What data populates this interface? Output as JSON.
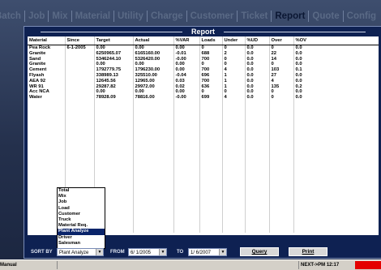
{
  "tabs": [
    "Batch",
    "Job",
    "Mix",
    "Material",
    "Utility",
    "Charge",
    "Customer",
    "Ticket",
    "Report",
    "Quote",
    "Config"
  ],
  "active_tab": "Report",
  "panel_title": "Report",
  "table": {
    "headers": [
      "Material",
      "Since",
      "Target",
      "Actual",
      "%VAR",
      "Loads",
      "Under",
      "%UD",
      "Over",
      "%OV"
    ],
    "rows": [
      [
        "Pea Rock",
        "6-1-2005",
        "0.00",
        "0.00",
        "0.00",
        "0",
        "0",
        "0.0",
        "0",
        "0.0"
      ],
      [
        "Granite",
        "",
        "6250965.07",
        "6165160.00",
        "-0.01",
        "688",
        "2",
        "0.0",
        "22",
        "0.0"
      ],
      [
        "Sand",
        "",
        "5346244.10",
        "5326420.00",
        "-0.00",
        "700",
        "0",
        "0.0",
        "14",
        "0.0"
      ],
      [
        "Granite",
        "",
        "0.00",
        "0.00",
        "0.00",
        "0",
        "0",
        "0.0",
        "0",
        "0.0"
      ],
      [
        "Cement",
        "",
        "1792779.75",
        "1796230.00",
        "0.00",
        "700",
        "4",
        "0.0",
        "103",
        "0.1"
      ],
      [
        "Flyash",
        "",
        "338989.13",
        "325510.00",
        "-0.04",
        "696",
        "1",
        "0.0",
        "27",
        "0.0"
      ],
      [
        "AEA 92",
        "",
        "12645.56",
        "12965.00",
        "0.03",
        "700",
        "1",
        "0.0",
        "4",
        "0.0"
      ],
      [
        "WR 91",
        "",
        "29287.82",
        "29972.00",
        "0.02",
        "636",
        "1",
        "0.0",
        "135",
        "0.2"
      ],
      [
        "Acc NCA",
        "",
        "0.00",
        "0.00",
        "0.00",
        "0",
        "0",
        "0.0",
        "0",
        "0.0"
      ],
      [
        "Water",
        "",
        "78928.09",
        "78816.00",
        "-0.00",
        "699",
        "4",
        "0.0",
        "0",
        "0.0"
      ]
    ]
  },
  "sort": {
    "label": "SORT BY",
    "selected": "Plant Analyze",
    "options": [
      "Total",
      "Mix",
      "Job",
      "Load",
      "Customer",
      "Truck",
      "Material Req.",
      "Plant Analyze",
      "Driver",
      "Salesman"
    ]
  },
  "from": {
    "label": "FROM",
    "value": "6/ 1/2005"
  },
  "to": {
    "label": "TO",
    "value": "1/ 6/2007"
  },
  "buttons": {
    "query": "Query",
    "print": "Print"
  },
  "status": {
    "left": "Manual",
    "right": "NEXT->PM 12:17"
  }
}
